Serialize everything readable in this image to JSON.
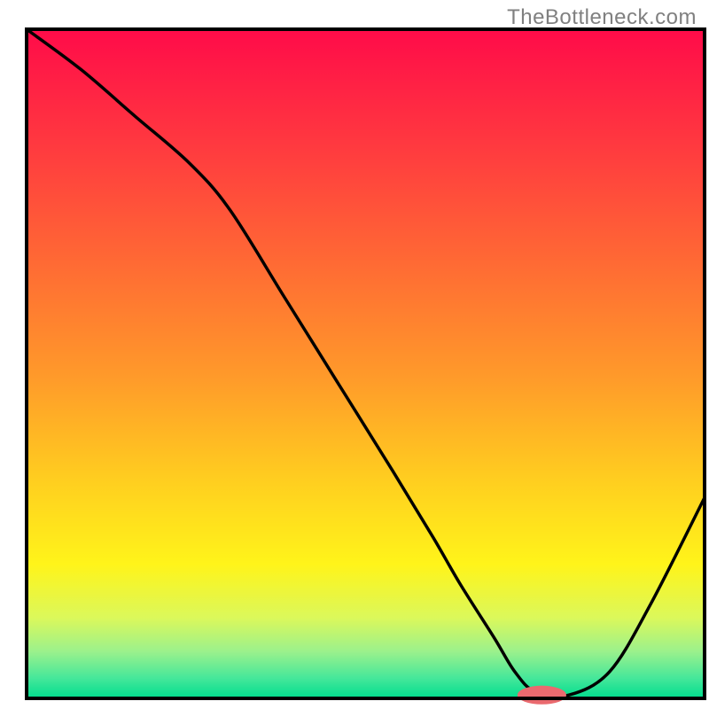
{
  "watermark": "TheBottleneck.com",
  "colors": {
    "frame": "#000000",
    "curve": "#000000",
    "marker_fill": "#ea6a6f",
    "gradient_stops": [
      {
        "offset": 0.0,
        "color": "#ff0b49"
      },
      {
        "offset": 0.18,
        "color": "#ff3b3f"
      },
      {
        "offset": 0.35,
        "color": "#ff6a34"
      },
      {
        "offset": 0.52,
        "color": "#ff9a2a"
      },
      {
        "offset": 0.68,
        "color": "#ffd01f"
      },
      {
        "offset": 0.8,
        "color": "#fff41a"
      },
      {
        "offset": 0.88,
        "color": "#dbf85b"
      },
      {
        "offset": 0.93,
        "color": "#9bf18c"
      },
      {
        "offset": 0.97,
        "color": "#45e79a"
      },
      {
        "offset": 1.0,
        "color": "#00dd8e"
      }
    ]
  },
  "chart_data": {
    "type": "line",
    "title": "",
    "xlabel": "",
    "ylabel": "",
    "xlim": [
      0,
      100
    ],
    "ylim": [
      0,
      100
    ],
    "grid": false,
    "legend": false,
    "series": [
      {
        "name": "curve",
        "x": [
          0,
          8,
          16,
          24,
          30,
          38,
          46,
          54,
          60,
          64,
          69,
          72,
          75,
          80,
          86,
          92,
          100
        ],
        "values": [
          100,
          94,
          87,
          80,
          73,
          60,
          47,
          34,
          24,
          17,
          9,
          4,
          1,
          0.5,
          4,
          14,
          30
        ]
      }
    ],
    "marker": {
      "x": 76,
      "y": 0.5,
      "rx": 3.6,
      "ry": 1.4
    }
  }
}
